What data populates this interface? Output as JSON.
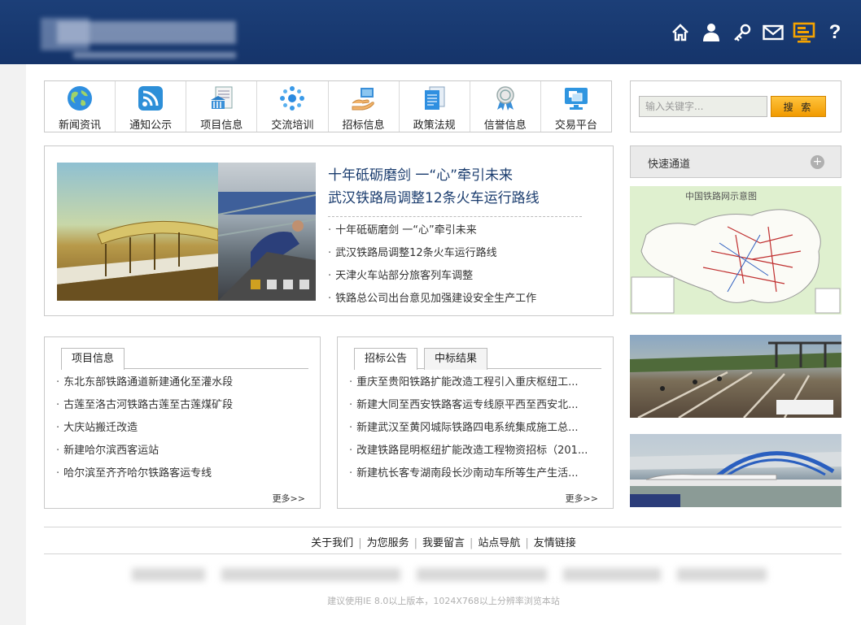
{
  "header": {
    "icons": [
      "home-icon",
      "user-icon",
      "key-icon",
      "mail-icon",
      "monitor-icon",
      "help-icon"
    ],
    "help_glyph": "?",
    "brand_color": "#1a3b72"
  },
  "nav": {
    "items": [
      {
        "label": "新闻资讯",
        "icon": "globe-icon"
      },
      {
        "label": "通知公示",
        "icon": "rss-icon"
      },
      {
        "label": "项目信息",
        "icon": "document-bank-icon"
      },
      {
        "label": "交流培训",
        "icon": "network-dots-icon"
      },
      {
        "label": "招标信息",
        "icon": "handshake-icon"
      },
      {
        "label": "政策法规",
        "icon": "documents-icon"
      },
      {
        "label": "信誉信息",
        "icon": "award-ribbon-icon"
      },
      {
        "label": "交易平台",
        "icon": "monitor-windows-icon"
      }
    ]
  },
  "search": {
    "placeholder": "输入关键字...",
    "button_label": "搜 索",
    "button_color": "#f5a300"
  },
  "news": {
    "headline_line1": "十年砥砺磨剑 一“心”牵引未来",
    "headline_line2": "武汉铁路局调整12条火车运行路线",
    "items": [
      "十年砥砺磨剑 一“心”牵引未来",
      "武汉铁路局调整12条火车运行路线",
      "天津火车站部分旅客列车调整",
      "铁路总公司出台意见加强建设安全生产工作"
    ],
    "slider_dots": 4,
    "active_dot": 1
  },
  "quick": {
    "label": "快速通道",
    "expand_glyph": "+",
    "map_title": "中国铁路网示意图"
  },
  "project": {
    "tab": "项目信息",
    "items": [
      "东北东部铁路通道新建通化至灌水段",
      "古莲至洛古河铁路古莲至古莲煤矿段",
      "大庆站搬迁改造",
      "新建哈尔滨西客运站",
      "哈尔滨至齐齐哈尔铁路客运专线"
    ],
    "more": "更多>>"
  },
  "bids": {
    "tabs": [
      "招标公告",
      "中标结果"
    ],
    "items": [
      "重庆至贵阳铁路扩能改造工程引入重庆枢纽工...",
      "新建大同至西安铁路客运专线原平西至西安北...",
      "新建武汉至黄冈城际铁路四电系统集成施工总...",
      "改建铁路昆明枢纽扩能改造工程物资招标（201...",
      "新建杭长客专湖南段长沙南动车所等生产生活..."
    ],
    "more": "更多>>"
  },
  "footer": {
    "links": [
      "关于我们",
      "为您服务",
      "我要留言",
      "站点导航",
      "友情链接"
    ],
    "separator": "|",
    "note": "建议使用IE 8.0以上版本，1024X768以上分辨率浏览本站"
  }
}
